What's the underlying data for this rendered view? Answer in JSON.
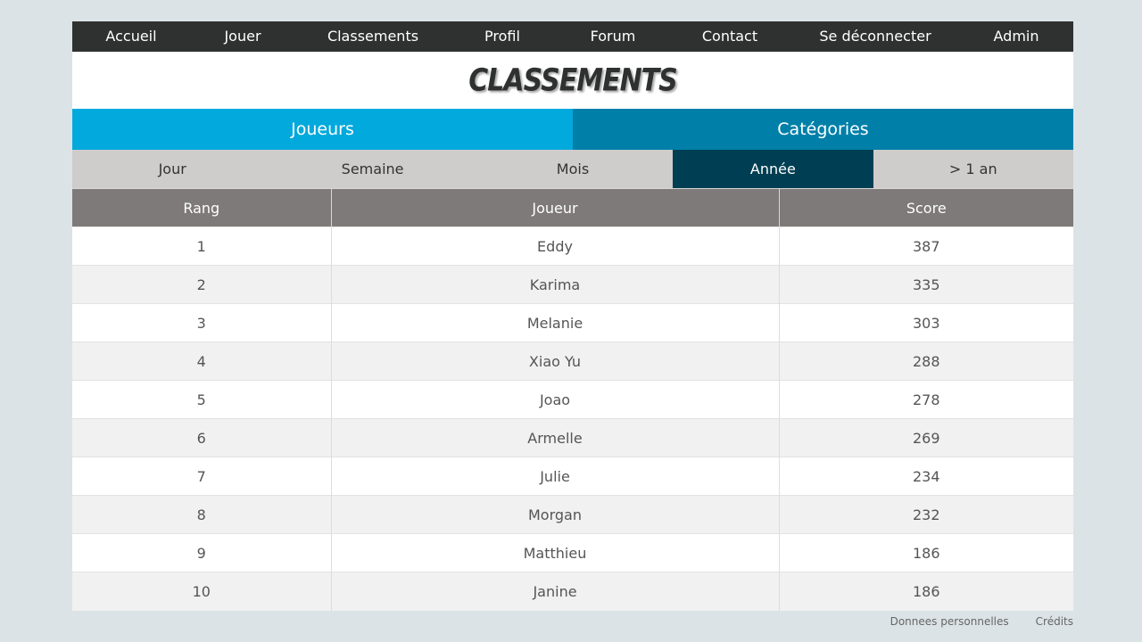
{
  "nav": [
    {
      "label": "Accueil",
      "name": "nav-accueil"
    },
    {
      "label": "Jouer",
      "name": "nav-jouer"
    },
    {
      "label": "Classements",
      "name": "nav-classements"
    },
    {
      "label": "Profil",
      "name": "nav-profil"
    },
    {
      "label": "Forum",
      "name": "nav-forum"
    },
    {
      "label": "Contact",
      "name": "nav-contact"
    },
    {
      "label": "Se déconnecter",
      "name": "nav-logout"
    },
    {
      "label": "Admin",
      "name": "nav-admin"
    }
  ],
  "title": "CLASSEMENTS",
  "main_tabs": [
    {
      "label": "Joueurs"
    },
    {
      "label": "Catégories"
    }
  ],
  "period_tabs": [
    {
      "label": "Jour"
    },
    {
      "label": "Semaine"
    },
    {
      "label": "Mois"
    },
    {
      "label": "Année",
      "active": true
    },
    {
      "label": "> 1 an"
    }
  ],
  "table": {
    "headers": [
      "Rang",
      "Joueur",
      "Score"
    ],
    "rows": [
      [
        "1",
        "Eddy",
        "387"
      ],
      [
        "2",
        "Karima",
        "335"
      ],
      [
        "3",
        "Melanie",
        "303"
      ],
      [
        "4",
        "Xiao Yu",
        "288"
      ],
      [
        "5",
        "Joao",
        "278"
      ],
      [
        "6",
        "Armelle",
        "269"
      ],
      [
        "7",
        "Julie",
        "234"
      ],
      [
        "8",
        "Morgan",
        "232"
      ],
      [
        "9",
        "Matthieu",
        "186"
      ],
      [
        "10",
        "Janine",
        "186"
      ]
    ]
  },
  "footer": {
    "privacy": "Donnees personnelles",
    "credits": "Crédits"
  }
}
